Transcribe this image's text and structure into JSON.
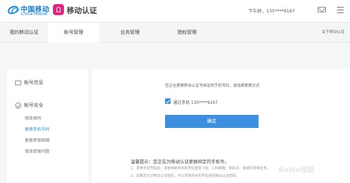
{
  "header": {
    "brand_cn": "中国移动",
    "brand_en": "China Mobile",
    "app_title": "移动认证",
    "greeting": "下午好，135****9167"
  },
  "nav": {
    "tabs": [
      {
        "label": "我的移动认证",
        "active": false
      },
      {
        "label": "帐号管理",
        "active": true
      },
      {
        "label": "业务管理",
        "active": false
      },
      {
        "label": "授权管理",
        "active": false
      }
    ],
    "right_link": "关于移动认证"
  },
  "sidebar": {
    "section1": "帐号信息",
    "section2": "帐号安全",
    "links": [
      "修改密码",
      "更换手机号码",
      "更换密保邮箱",
      "修改密保问题"
    ],
    "active_link": "更换手机号码"
  },
  "main": {
    "hint": "您正在更换移动认证号绑定的手机号码，请选择更换方式",
    "phone_option": "通过手机 135****9167",
    "confirm_label": "确定",
    "tips_title": "温馨提示：您正在为移动认证更换绑定的手机号。",
    "tips": [
      "1、更换手机号码后，请使用新的本机号码登录飞信、139邮箱、和彩云、和通讯录等业务。",
      "2、如果您忘记移动认证密码，可以凭新的手机号码找回移动认证密码。"
    ]
  },
  "watermark": "Baidu经验",
  "colors": {
    "brand_blue": "#1a7fd1",
    "accent_blue": "#3d8fe0",
    "app_icon_pink": "#e4227f",
    "page_bg": "#f5f6f8"
  }
}
